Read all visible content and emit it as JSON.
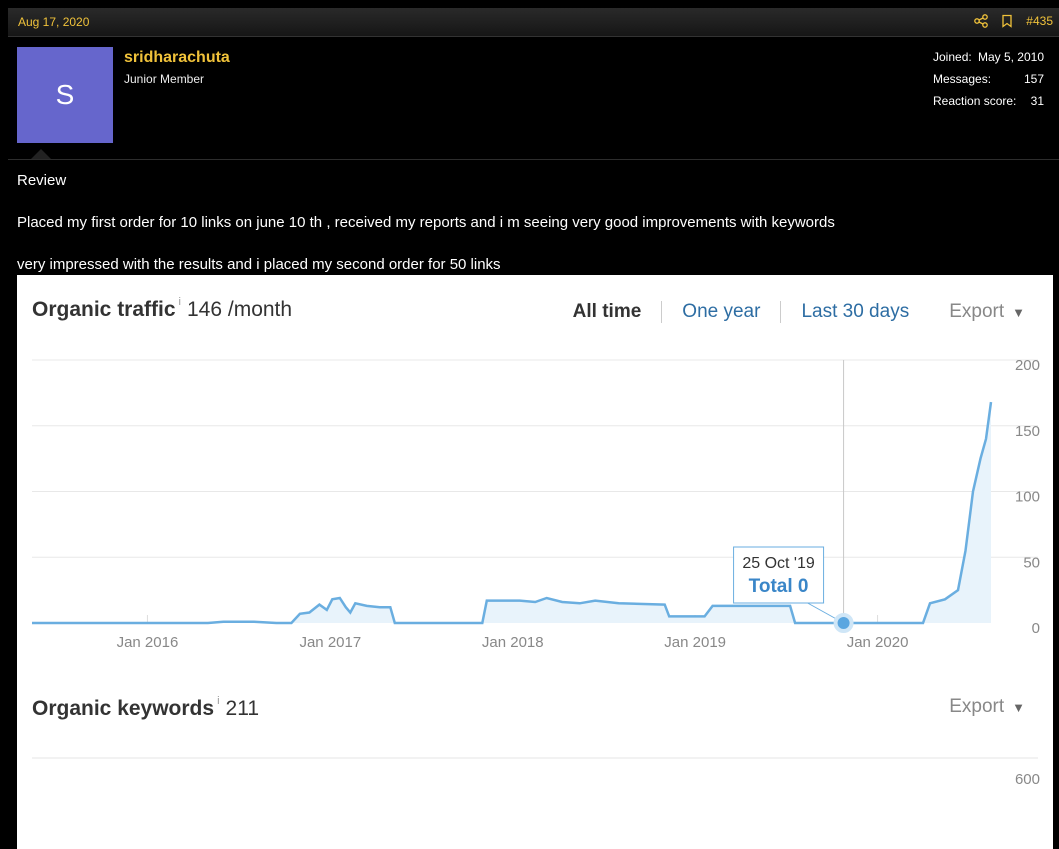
{
  "post": {
    "date": "Aug 17, 2020",
    "number": "#435",
    "icons": [
      "share-icon",
      "bookmark-icon"
    ]
  },
  "user": {
    "avatar_letter": "S",
    "avatar_color": "#6666cc",
    "name": "sridharachuta",
    "title": "Junior Member",
    "stats": [
      {
        "label": "Joined:",
        "value": "May 5, 2010"
      },
      {
        "label": "Messages:",
        "value": "157"
      },
      {
        "label": "Reaction score:",
        "value": "31"
      }
    ]
  },
  "message": {
    "heading": "Review",
    "line1": "Placed my first order for 10 links on june 10 th , received my reports and i m seeing very good improvements with keywords",
    "line2": "very impressed with the results and i placed my second order for 50 links"
  },
  "panel": {
    "traffic": {
      "title": "Organic traffic",
      "info": "i",
      "value": "146 /month"
    },
    "tabs": [
      "All time",
      "One year",
      "Last 30 days"
    ],
    "export_label": "Export",
    "keywords": {
      "title": "Organic keywords",
      "info": "i",
      "value": "211",
      "export_label": "Export",
      "y_tick_top": "600"
    }
  },
  "colors": {
    "accent": "#f0c23a",
    "line": "#6aaee0",
    "fill": "#e8f3fb",
    "link": "#2d6da3"
  },
  "chart_data": {
    "type": "area",
    "title": "",
    "xlabel": "",
    "ylabel": "",
    "ylim": [
      0,
      200
    ],
    "y_ticks": [
      "0",
      "50",
      "100",
      "150",
      "200"
    ],
    "x_ticks": [
      {
        "label": "Jan 2016",
        "x": "2016-01-01"
      },
      {
        "label": "Jan 2017",
        "x": "2017-01-01"
      },
      {
        "label": "Jan 2018",
        "x": "2018-01-01"
      },
      {
        "label": "Jan 2019",
        "x": "2019-01-01"
      },
      {
        "label": "Jan 2020",
        "x": "2020-01-01"
      }
    ],
    "xlim": [
      "2015-05-15",
      "2020-08-17"
    ],
    "series": [
      {
        "points": [
          [
            "2015-05-15",
            0
          ],
          [
            "2016-05-01",
            0
          ],
          [
            "2016-06-01",
            1
          ],
          [
            "2016-08-01",
            1
          ],
          [
            "2016-09-15",
            0
          ],
          [
            "2016-10-15",
            0
          ],
          [
            "2016-11-01",
            7
          ],
          [
            "2016-11-20",
            8
          ],
          [
            "2016-12-10",
            14
          ],
          [
            "2016-12-25",
            10
          ],
          [
            "2017-01-05",
            18
          ],
          [
            "2017-01-20",
            19
          ],
          [
            "2017-02-01",
            12
          ],
          [
            "2017-02-10",
            8
          ],
          [
            "2017-02-20",
            15
          ],
          [
            "2017-03-15",
            13
          ],
          [
            "2017-04-10",
            12
          ],
          [
            "2017-05-01",
            12
          ],
          [
            "2017-05-10",
            0
          ],
          [
            "2017-11-01",
            0
          ],
          [
            "2017-11-10",
            17
          ],
          [
            "2018-01-15",
            17
          ],
          [
            "2018-02-15",
            16
          ],
          [
            "2018-03-10",
            19
          ],
          [
            "2018-04-10",
            16
          ],
          [
            "2018-05-15",
            15
          ],
          [
            "2018-06-15",
            17
          ],
          [
            "2018-08-01",
            15
          ],
          [
            "2018-11-01",
            14
          ],
          [
            "2018-11-10",
            5
          ],
          [
            "2019-01-20",
            5
          ],
          [
            "2019-02-05",
            13
          ],
          [
            "2019-03-25",
            13
          ],
          [
            "2019-04-10",
            13
          ],
          [
            "2019-07-10",
            13
          ],
          [
            "2019-07-20",
            0
          ],
          [
            "2020-04-01",
            0
          ],
          [
            "2020-04-15",
            15
          ],
          [
            "2020-05-15",
            18
          ],
          [
            "2020-06-10",
            25
          ],
          [
            "2020-06-25",
            55
          ],
          [
            "2020-07-10",
            100
          ],
          [
            "2020-07-25",
            125
          ],
          [
            "2020-08-05",
            140
          ],
          [
            "2020-08-15",
            168
          ]
        ]
      }
    ],
    "tooltip": {
      "date_label": "25 Oct '19",
      "total_label": "Total 0",
      "x": "2019-10-25",
      "y": 0
    }
  }
}
